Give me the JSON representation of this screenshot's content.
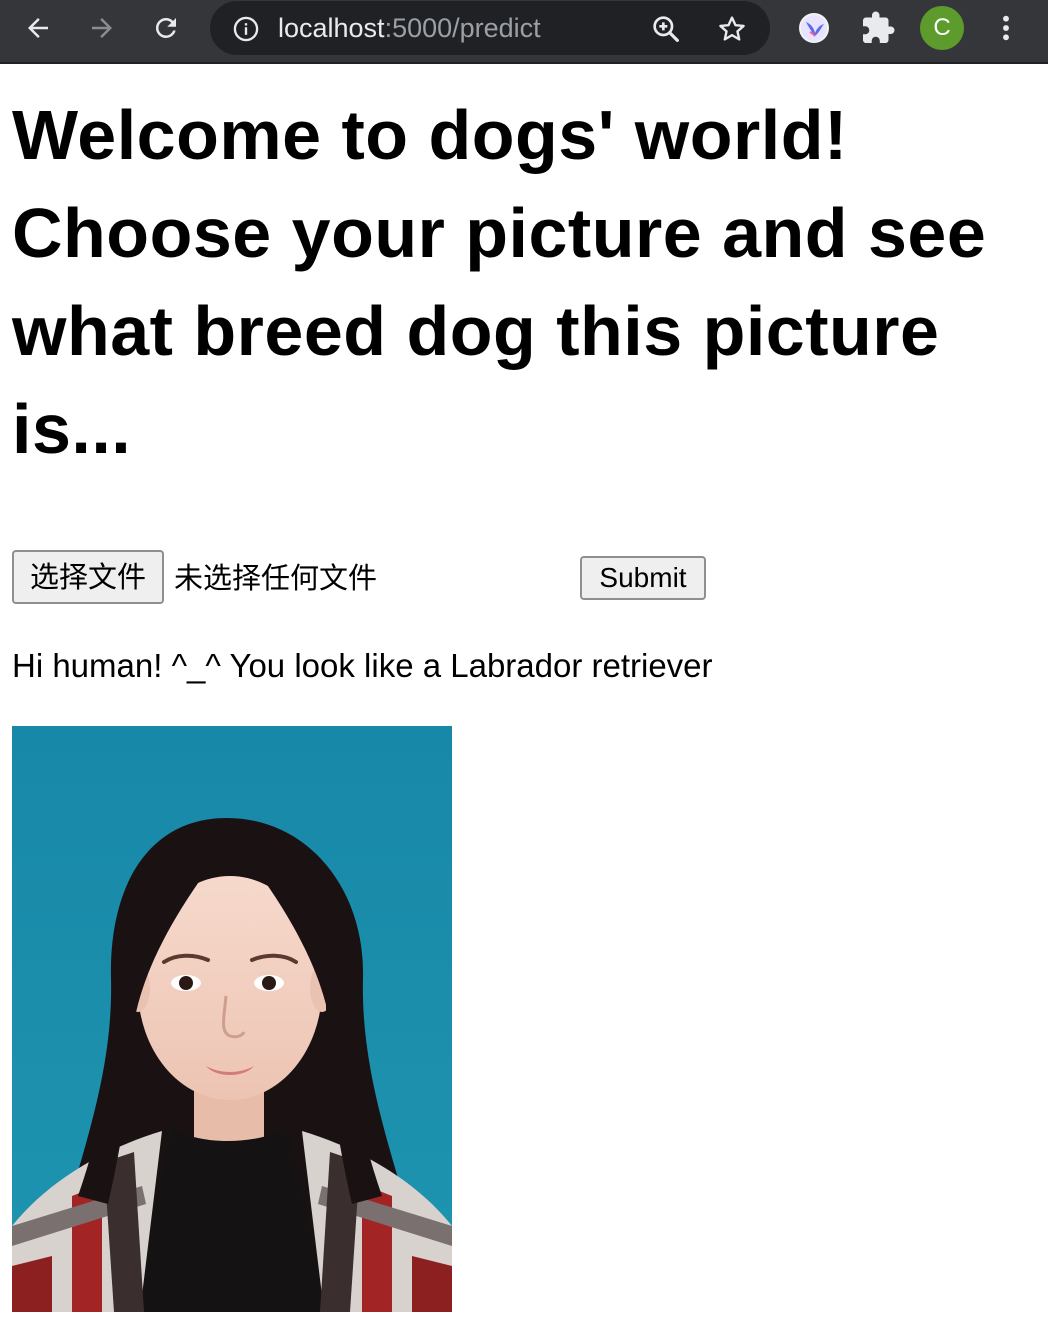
{
  "browser": {
    "url_host": "localhost",
    "url_path": ":5000/predict",
    "profile_initial": "C",
    "icons": {
      "back": "arrow-left-icon",
      "forward": "arrow-right-icon",
      "reload": "reload-icon",
      "site_info": "info-icon",
      "zoom": "zoom-in-icon",
      "bookmark": "star-icon",
      "extension": "bird-extension-icon",
      "extensions_menu": "puzzle-icon",
      "menu": "vertical-dots-icon"
    }
  },
  "page": {
    "heading": "Welcome to dogs' world! Choose your picture and see what breed dog this picture is...",
    "file_input": {
      "button_label": "选择文件",
      "status_text": "未选择任何文件"
    },
    "submit_label": "Submit",
    "result_text": "Hi human! ^_^ You look like a Labrador retriever",
    "photo": {
      "subject": "portrait photo of a young woman with long dark hair against a blue background",
      "background_color": "#1a8aa6"
    }
  }
}
